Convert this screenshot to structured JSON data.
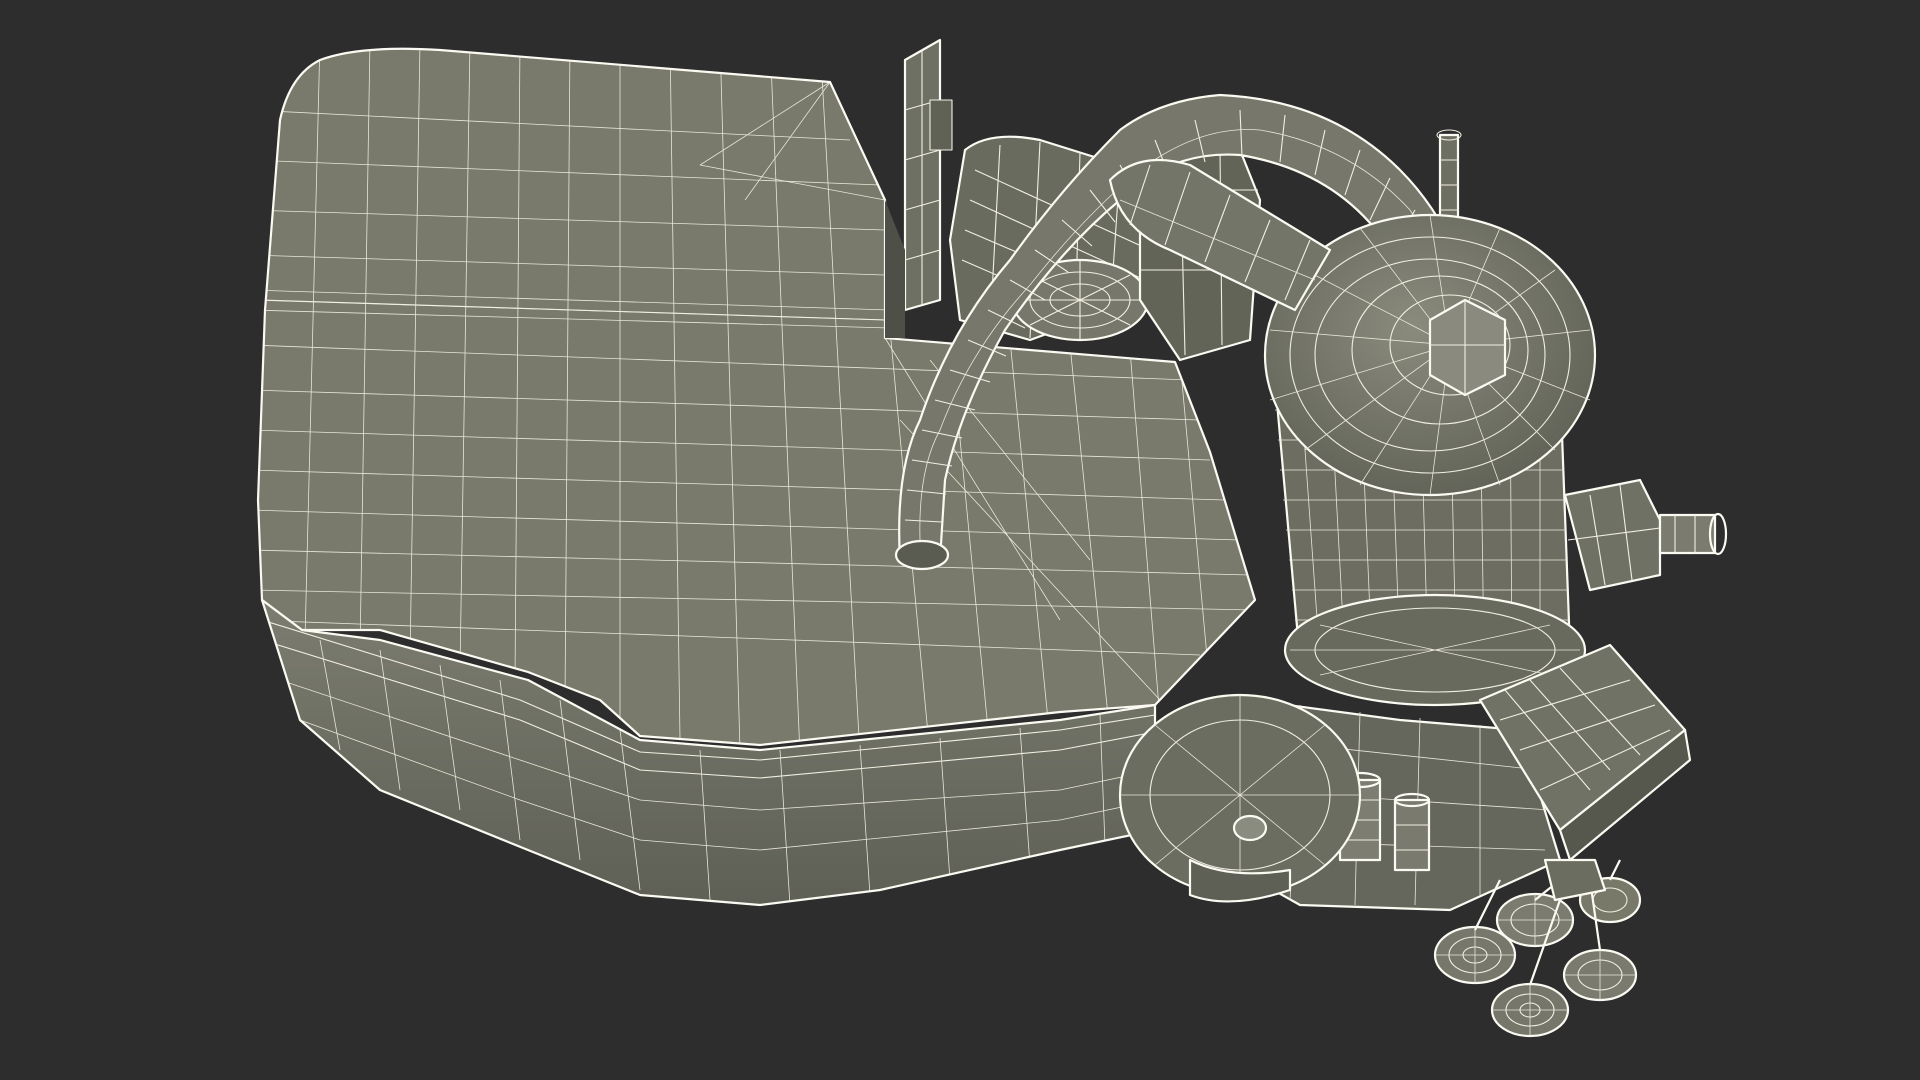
{
  "scene": {
    "subject": "",
    "render_style": "",
    "background_color": "#2d2d2d",
    "surface_color": "#7a7b6d",
    "wire_color": "#f1efe2"
  }
}
